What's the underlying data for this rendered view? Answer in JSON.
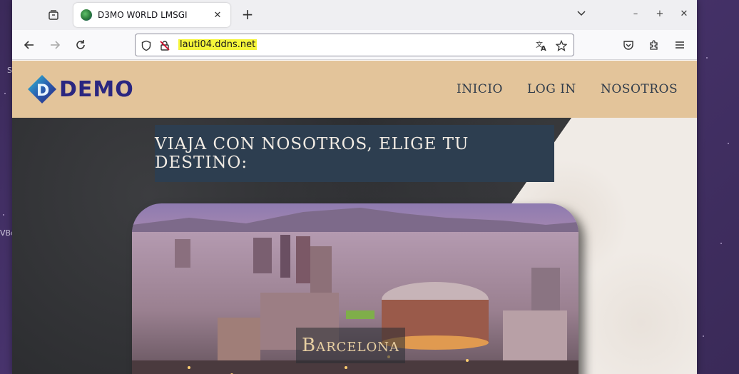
{
  "browser": {
    "tab": {
      "title": "D3MO W0RLD LMSGI",
      "favicon": "globe-favicon"
    },
    "new_tab_label": "+",
    "url": "lauti04.ddns.net",
    "window_controls": {
      "minimize": "–",
      "maximize": "+",
      "close": "✕"
    }
  },
  "desktop": {
    "labels": [
      "S",
      "VBo"
    ]
  },
  "site": {
    "logo_text": "DEMO",
    "nav": [
      "INICIO",
      "LOG IN",
      "NOSOTROS"
    ],
    "hero_title": "VIAJA CON NOSOTROS, ELIGE TU DESTINO:",
    "destination": "Barcelona"
  },
  "colors": {
    "header_bg": "#e3c49a",
    "title_box_bg": "#2d3e50",
    "logo_text": "#2a2680",
    "url_highlight": "#f5f53a"
  }
}
